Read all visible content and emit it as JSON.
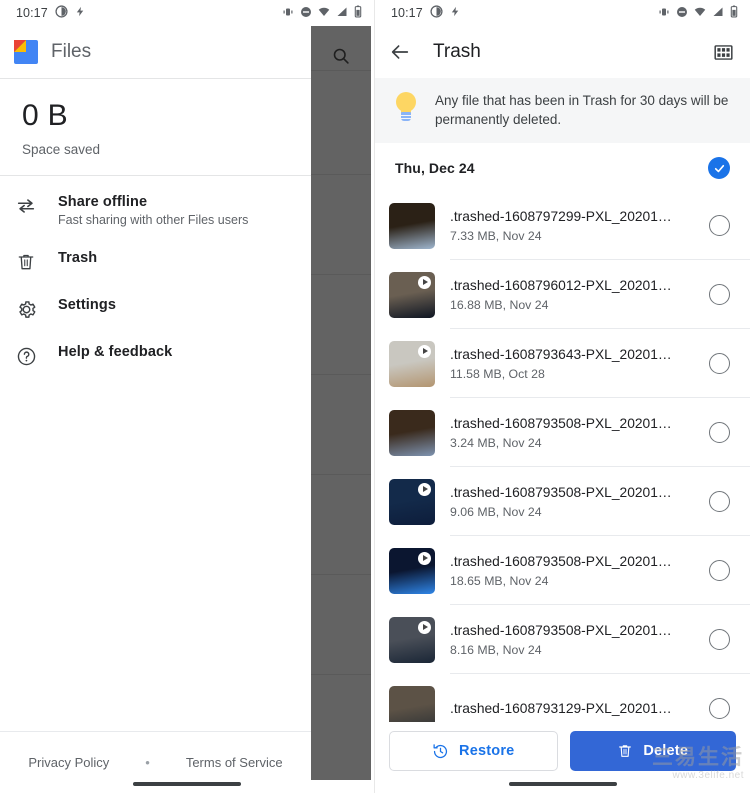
{
  "status_bar": {
    "time": "10:17",
    "left_icons": [
      "night-light-icon",
      "battery-saver-icon"
    ],
    "right_icons": [
      "vibrate-icon",
      "do-not-disturb-icon",
      "wifi-icon",
      "cellular-signal-icon",
      "battery-icon"
    ]
  },
  "left_screen": {
    "drawer": {
      "app_name": "Files",
      "app_icon": "files-logo-icon",
      "space_saved_amount": "0 B",
      "space_saved_label": "Space saved",
      "items": [
        {
          "label": "Share offline",
          "sub": "Fast sharing with other Files users",
          "icon": "share-offline-icon"
        },
        {
          "label": "Trash",
          "sub": "",
          "icon": "trash-icon"
        },
        {
          "label": "Settings",
          "sub": "",
          "icon": "gear-icon"
        },
        {
          "label": "Help & feedback",
          "sub": "",
          "icon": "help-circle-icon"
        }
      ],
      "footer": {
        "privacy": "Privacy Policy",
        "separator": "•",
        "terms": "Terms of Service"
      }
    },
    "scrim": {
      "search_icon": "search-icon",
      "color": "#636363"
    }
  },
  "right_screen": {
    "appbar": {
      "back_icon": "back-arrow-icon",
      "title": "Trash",
      "grid_icon": "grid-view-icon"
    },
    "tip": {
      "icon": "lightbulb-icon",
      "text": "Any file that has been in Trash for 30 days will be permanently deleted."
    },
    "date_group": {
      "label": "Thu, Dec 24",
      "selected": true,
      "check_icon": "check-circle-icon"
    },
    "files": [
      {
        "name": ".trashed-1608797299-PXL_20201…",
        "meta": "7.33 MB, Nov 24",
        "is_video": false,
        "selected": false,
        "thumb_top": "#2b2116",
        "thumb_bottom": "#9fb6cf"
      },
      {
        "name": ".trashed-1608796012-PXL_20201…",
        "meta": "16.88 MB, Nov 24",
        "is_video": true,
        "selected": false,
        "thumb_top": "#6a5f52",
        "thumb_bottom": "#0e1522"
      },
      {
        "name": ".trashed-1608793643-PXL_20201…",
        "meta": "11.58 MB, Oct 28",
        "is_video": true,
        "selected": false,
        "thumb_top": "#c9c7c0",
        "thumb_bottom": "#b39570"
      },
      {
        "name": ".trashed-1608793508-PXL_20201…",
        "meta": "3.24 MB, Nov 24",
        "is_video": false,
        "selected": false,
        "thumb_top": "#3a2a1c",
        "thumb_bottom": "#7e93b0"
      },
      {
        "name": ".trashed-1608793508-PXL_20201…",
        "meta": "9.06 MB, Nov 24",
        "is_video": true,
        "selected": false,
        "thumb_top": "#132a4a",
        "thumb_bottom": "#0d1d3b"
      },
      {
        "name": ".trashed-1608793508-PXL_20201…",
        "meta": "18.65 MB, Nov 24",
        "is_video": true,
        "selected": false,
        "thumb_top": "#0b1630",
        "thumb_bottom": "#2f86e8"
      },
      {
        "name": ".trashed-1608793508-PXL_20201…",
        "meta": "8.16 MB, Nov 24",
        "is_video": true,
        "selected": false,
        "thumb_top": "#4a4f58",
        "thumb_bottom": "#1a2636"
      },
      {
        "name": ".trashed-1608793129-PXL_20201…",
        "meta": "",
        "is_video": false,
        "selected": false,
        "thumb_top": "#5c5246",
        "thumb_bottom": "#2a2f33"
      }
    ],
    "actions": {
      "restore_label": "Restore",
      "restore_icon": "restore-clock-icon",
      "delete_label": "Delete",
      "delete_icon": "trash-icon",
      "restore_color": "#1a73e8",
      "delete_color": "#3367d6"
    }
  },
  "watermark": {
    "cn": "三易生活",
    "url": "www.3elife.net"
  }
}
